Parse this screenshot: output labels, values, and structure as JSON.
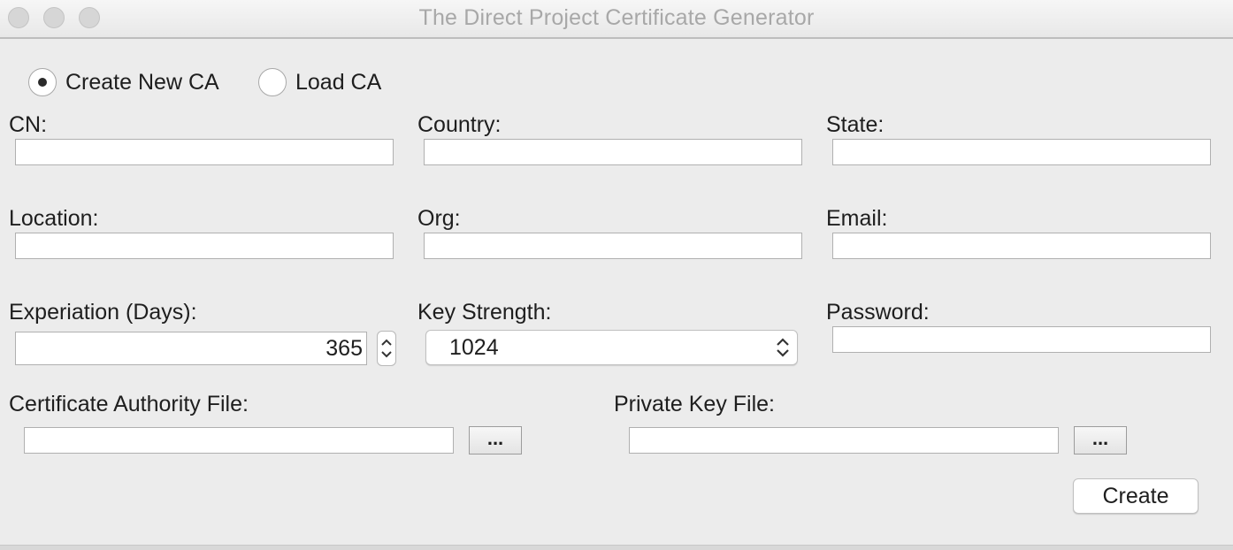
{
  "window": {
    "title": "The Direct Project Certificate Generator"
  },
  "mode": {
    "create_new_label": "Create New CA",
    "load_label": "Load CA",
    "selected": "create_new"
  },
  "fields": {
    "cn_label": "CN:",
    "cn_value": "",
    "country_label": "Country:",
    "country_value": "",
    "state_label": "State:",
    "state_value": "",
    "location_label": "Location:",
    "location_value": "",
    "org_label": "Org:",
    "org_value": "",
    "email_label": "Email:",
    "email_value": "",
    "expiration_label": "Experiation (Days):",
    "expiration_value": "365",
    "key_strength_label": "Key Strength:",
    "key_strength_value": "1024",
    "password_label": "Password:",
    "password_value": ""
  },
  "files": {
    "ca_file_label": "Certificate Authority File:",
    "ca_file_value": "",
    "ca_browse_label": "...",
    "private_key_label": "Private Key File:",
    "private_key_value": "",
    "private_key_browse_label": "..."
  },
  "actions": {
    "create_label": "Create"
  }
}
